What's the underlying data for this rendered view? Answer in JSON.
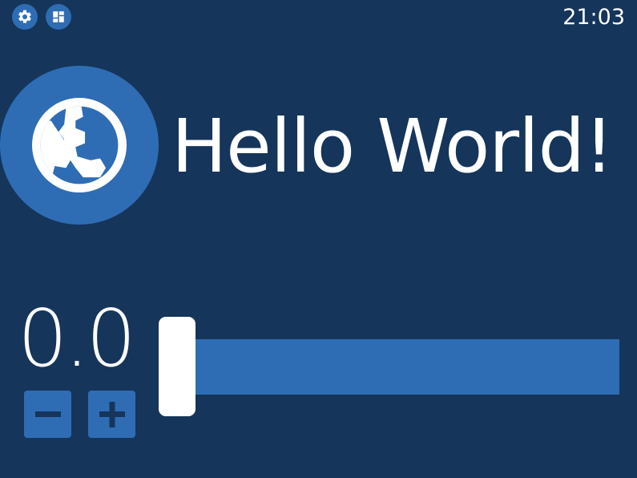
{
  "status_bar": {
    "time": "21:03",
    "icons": [
      "gear-icon",
      "dashboard-icon"
    ]
  },
  "main": {
    "headline": "Hello World!",
    "icon": "globe-icon"
  },
  "control": {
    "value_text": "0.0",
    "slider_fraction": 0.0,
    "decrement_icon": "minus-icon",
    "increment_icon": "plus-icon"
  },
  "colors": {
    "background": "#15355a",
    "accent": "#2e6db4",
    "foreground": "#ffffff"
  }
}
